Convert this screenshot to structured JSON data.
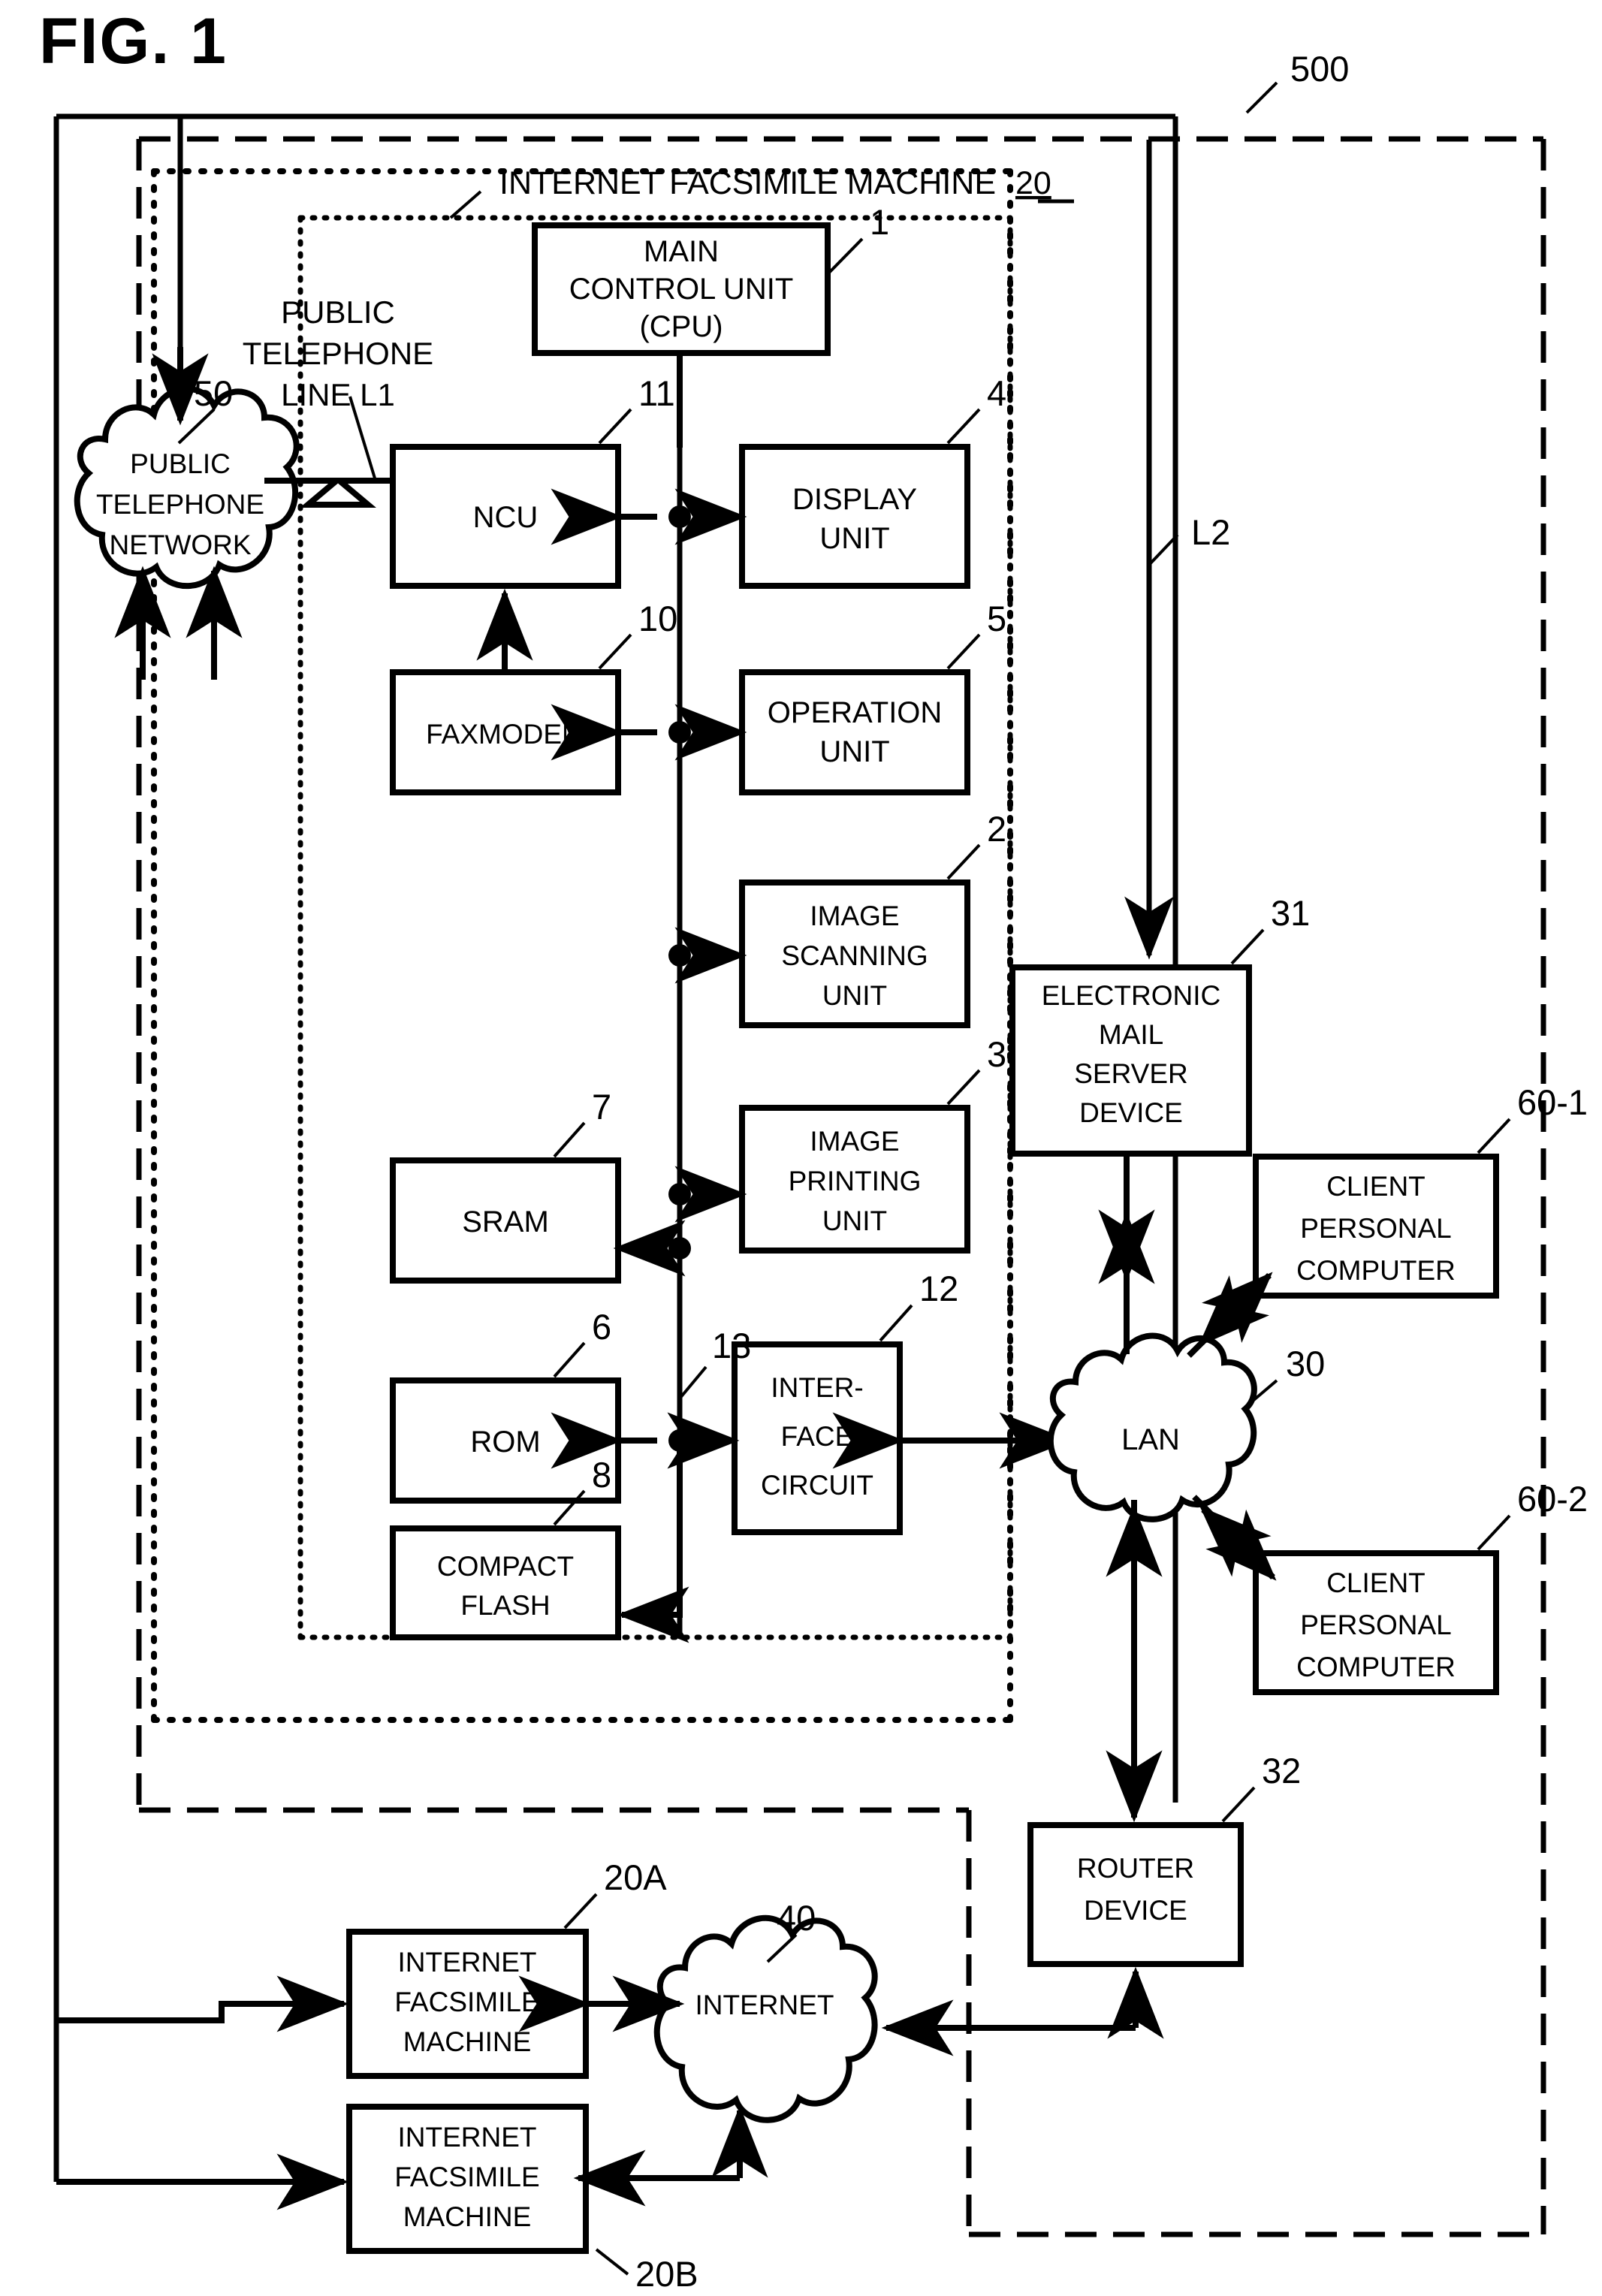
{
  "figure": {
    "label": "FIG. 1",
    "system_ref": "500",
    "inner_title": "INTERNET FACSIMILE MACHINE",
    "inner_title_ref": "20"
  },
  "lines": {
    "l1_label": "PUBLIC\nTELEPHONE\nLINE L1",
    "l1_line1": "PUBLIC",
    "l1_line2": "TELEPHONE",
    "l1_line3": "LINE L1",
    "l2_label": "L2",
    "bus_ref": "13"
  },
  "clouds": [
    {
      "name": "public-telephone-network",
      "l1": "PUBLIC",
      "l2": "TELEPHONE",
      "l3": "NETWORK",
      "ref": "50"
    },
    {
      "name": "lan",
      "l1": "LAN",
      "ref": "30"
    },
    {
      "name": "internet",
      "l1": "INTERNET",
      "ref": "40"
    }
  ],
  "blocks": [
    {
      "name": "main-control-unit",
      "l1": "MAIN",
      "l2": "CONTROL UNIT",
      "l3": "(CPU)",
      "ref": "1"
    },
    {
      "name": "ncu",
      "l1": "NCU",
      "ref": "11"
    },
    {
      "name": "display-unit",
      "l1": "DISPLAY",
      "l2": "UNIT",
      "ref": "4"
    },
    {
      "name": "faxmodem",
      "l1": "FAXMODEM",
      "ref": "10"
    },
    {
      "name": "operation-unit",
      "l1": "OPERATION",
      "l2": "UNIT",
      "ref": "5"
    },
    {
      "name": "image-scanning-unit",
      "l1": "IMAGE",
      "l2": "SCANNING",
      "l3": "UNIT",
      "ref": "2"
    },
    {
      "name": "image-printing-unit",
      "l1": "IMAGE",
      "l2": "PRINTING",
      "l3": "UNIT",
      "ref": "3"
    },
    {
      "name": "sram",
      "l1": "SRAM",
      "ref": "7"
    },
    {
      "name": "rom",
      "l1": "ROM",
      "ref": "6"
    },
    {
      "name": "compact-flash",
      "l1": "COMPACT",
      "l2": "FLASH",
      "ref": "8"
    },
    {
      "name": "interface-circuit",
      "l1": "INTER-",
      "l2": "FACE",
      "l3": "CIRCUIT",
      "ref": "12"
    },
    {
      "name": "electronic-mail-server-device",
      "l1": "ELECTRONIC",
      "l2": "MAIL",
      "l3": "SERVER",
      "l4": "DEVICE",
      "ref": "31"
    },
    {
      "name": "client-personal-computer-1",
      "l1": "CLIENT",
      "l2": "PERSONAL",
      "l3": "COMPUTER",
      "ref": "60-1"
    },
    {
      "name": "client-personal-computer-2",
      "l1": "CLIENT",
      "l2": "PERSONAL",
      "l3": "COMPUTER",
      "ref": "60-2"
    },
    {
      "name": "router-device",
      "l1": "ROUTER",
      "l2": "DEVICE",
      "ref": "32"
    },
    {
      "name": "internet-facsimile-machine-a",
      "l1": "INTERNET",
      "l2": "FACSIMILE",
      "l3": "MACHINE",
      "ref": "20A"
    },
    {
      "name": "internet-facsimile-machine-b",
      "l1": "INTERNET",
      "l2": "FACSIMILE",
      "l3": "MACHINE",
      "ref": "20B"
    }
  ],
  "colors": {
    "ink": "#000000",
    "paper": "#ffffff"
  }
}
